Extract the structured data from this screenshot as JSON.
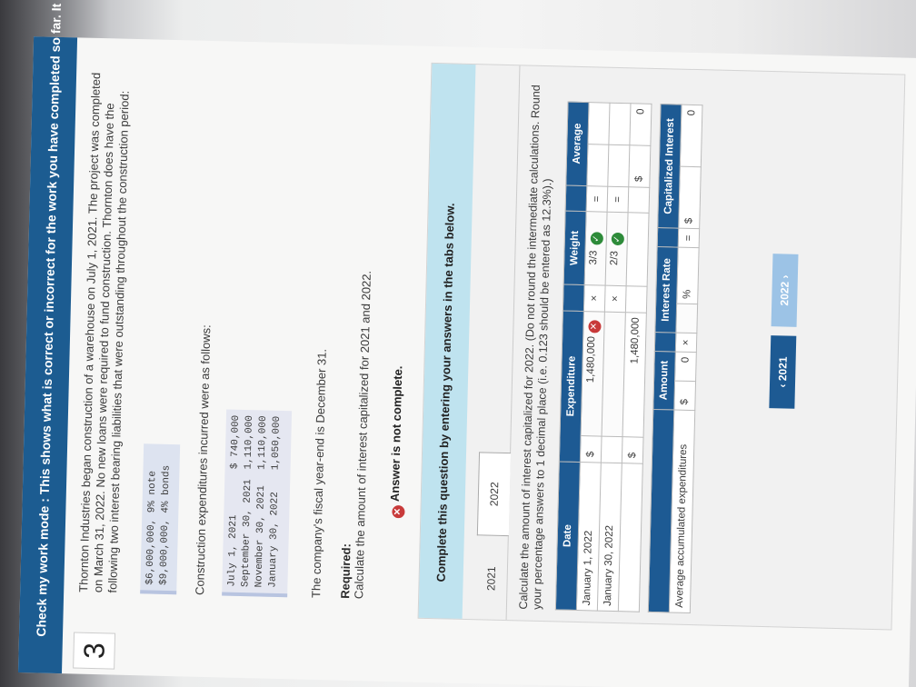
{
  "header": {
    "text": "Check my work mode : This shows what is correct or incorrect for the work you have completed so far. It does not indicate"
  },
  "question_number": "3",
  "intro": "Thornton Industries began construction of a warehouse on July 1, 2021. The project was completed on March 31, 2022. No new loans were required to fund construction. Thornton does have the following two interest bearing liabilities that were outstanding throughout the construction period:",
  "loans": [
    "$6,000,000, 9% note",
    "$9,000,000, 4% bonds"
  ],
  "construction_label": "Construction expenditures incurred were as follows:",
  "expenditures": [
    {
      "date": "July 1, 2021",
      "amount": "$ 740,000"
    },
    {
      "date": "September 30, 2021",
      "amount": "1,110,000"
    },
    {
      "date": "November 30, 2021",
      "amount": "1,110,000"
    },
    {
      "date": "January 30, 2022",
      "amount": "1,050,000"
    }
  ],
  "fiscal": "The company's fiscal year-end is December 31.",
  "required_label": "Required:",
  "required_text": "Calculate the amount of interest capitalized for 2021 and 2022.",
  "status": "Answer is not complete.",
  "panel_title": "Complete this question by entering your answers in the tabs below.",
  "tabs": [
    "2021",
    "2022"
  ],
  "instructions": "Calculate the amount of interest capitalized for 2022. (Do not round the intermediate calculations. Round your percentage answers to 1 decimal place (i.e. 0.123 should be entered as 12.3%).)",
  "table1": {
    "headers": [
      "Date",
      "Expenditure",
      "",
      "Weight",
      "",
      "Average"
    ],
    "rows": [
      {
        "date": "January 1, 2022",
        "dollar": "$",
        "expenditure": "1,480,000",
        "op": "×",
        "weight": "3/3",
        "eq": "=",
        "average": ""
      },
      {
        "date": "January 30, 2022",
        "dollar": "",
        "expenditure": "",
        "op": "×",
        "weight": "2/3",
        "eq": "=",
        "average": ""
      },
      {
        "date": "",
        "dollar": "$",
        "expenditure": "1,480,000",
        "op": "",
        "weight": "",
        "eq": "",
        "average_dollar": "$",
        "average": "0"
      }
    ]
  },
  "table2": {
    "headers": [
      "",
      "Amount",
      "",
      "Interest Rate",
      "",
      "Capitalized Interest"
    ],
    "row": {
      "label": "Average accumulated expenditures",
      "dollar": "$",
      "amount": "0",
      "op": "×",
      "rate_suffix": "%",
      "op2": "×",
      "eq": "=",
      "dollar2": "$",
      "interest": "0"
    }
  },
  "nav": {
    "prev": "‹  2021",
    "next": "2022 ›"
  }
}
